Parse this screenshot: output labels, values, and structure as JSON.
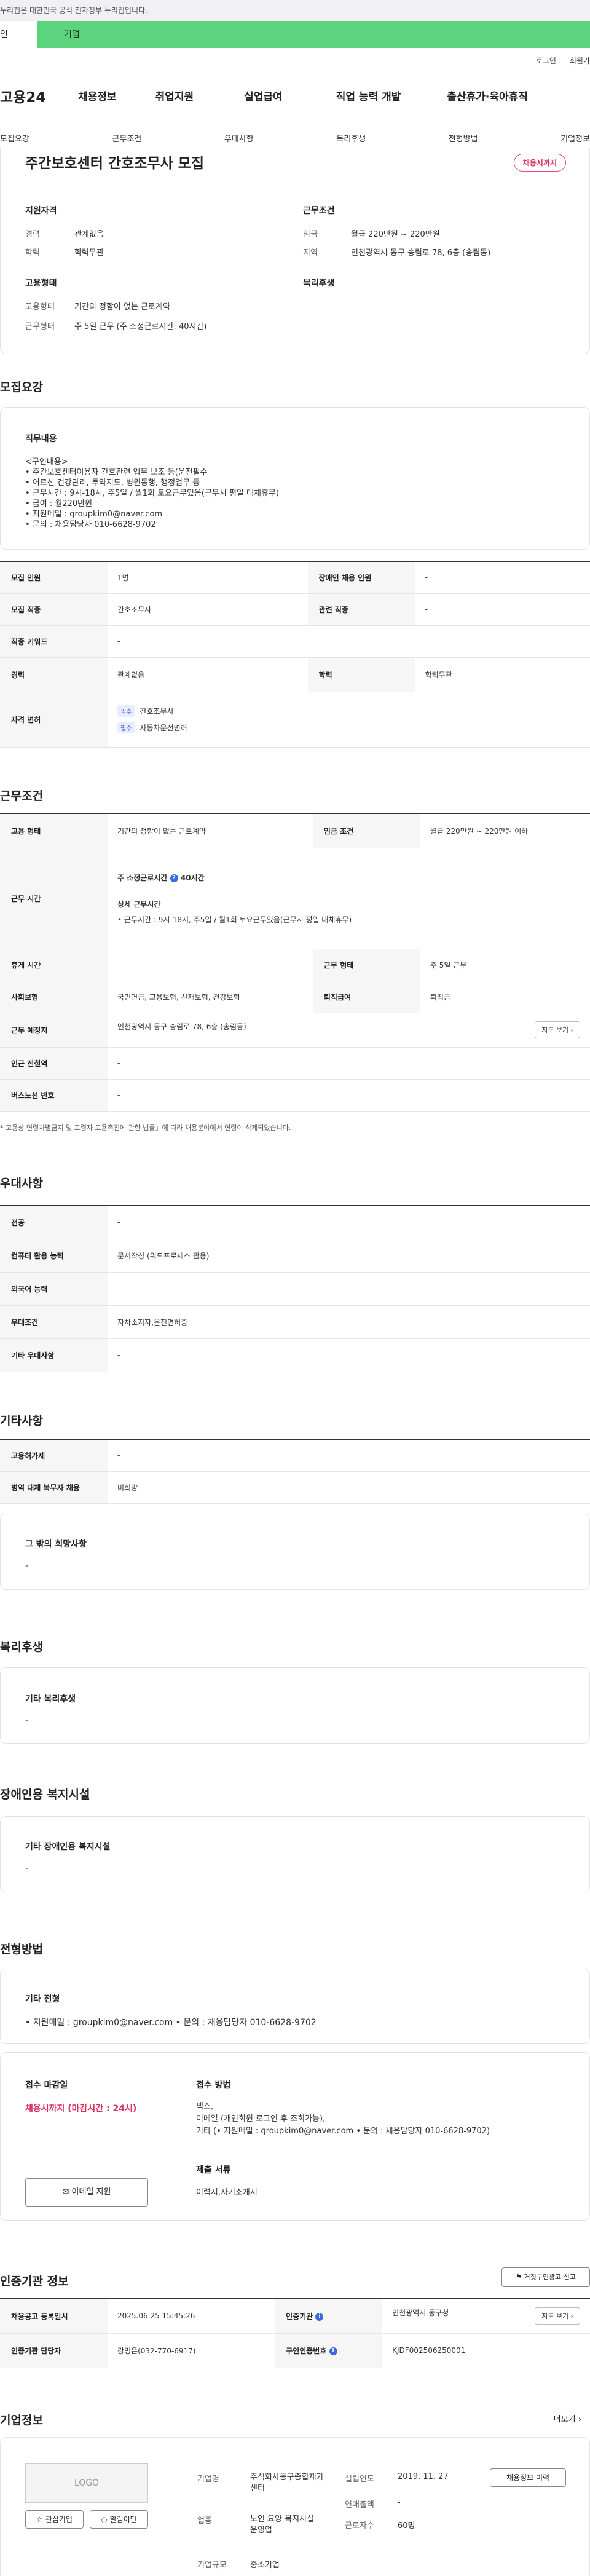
{
  "gov_banner": "누리집은 대한민국 공식 전자정부 누리집입니다.",
  "user_tabs": [
    "인",
    "기업"
  ],
  "util": {
    "login": "로그인",
    "join": "회원가"
  },
  "gnb": {
    "logo": "고용24",
    "items": [
      "채용정보",
      "취업지원",
      "실업급여",
      "직업 능력 개발",
      "출산휴가·육아휴직"
    ]
  },
  "subnav": [
    "모집요강",
    "근무조건",
    "우대사항",
    "복리후생",
    "전형방법",
    "기업정보"
  ],
  "header": {
    "title": "주간보호센터 간호조무사 모집",
    "badge": "채용시까지",
    "qual_title": "지원자격",
    "career_label": "경력",
    "career": "관계없음",
    "edu_label": "학력",
    "edu": "학력무관",
    "cond_title": "근무조건",
    "wage_label": "임금",
    "wage": "월급 220만원 ~ 220만원",
    "loc_label": "지역",
    "loc": "인천광역시 동구 송림로 78, 6층 (송림동)",
    "emp_title": "고용형태",
    "emptype_label": "고용형태",
    "emptype": "기간의 정함이 없는 근로계약",
    "work_label": "근무형태",
    "work": "주 5일 근무 (주 소정근로시간: 40시간)",
    "welfare_title": "복리후생"
  },
  "recruit": {
    "section": "모집요강",
    "duty_title": "직무내용",
    "duty_lines": [
      "<구인내용>",
      "• 주간보호센터이용자 간호관련 업무 보조 등(운전필수",
      "• 어르신 건강관리, 투약지도, 병원동행, 행정업무 등",
      "• 근무시간 : 9시-18시, 주5일 / 월1회 토요근무있음(근무시 평일 대체휴무)",
      "• 급여 : 월220만원",
      "• 지원메일 : groupkim0@naver.com",
      "• 문의 : 채용담당자 010-6628-9702"
    ],
    "rows": {
      "count_label": "모집 인원",
      "count": "1명",
      "disabled_label": "장애인 채용 인원",
      "disabled": "-",
      "job_label": "모집 직종",
      "job": "간호조무사",
      "rel_label": "관련 직종",
      "rel": "-",
      "keyword_label": "직종 키워드",
      "keyword": "-",
      "career_label": "경력",
      "career": "관계없음",
      "edu_label": "학력",
      "edu": "학력무관",
      "license_label": "자격 면허",
      "license_tag": "필수",
      "licenses": [
        "간호조무사",
        "자동차운전면허"
      ]
    }
  },
  "conditions": {
    "section": "근무조건",
    "emptype_label": "고용 형태",
    "emptype": "기간의 정함이 없는 근로계약",
    "wage_label": "임금 조건",
    "wage": "월급 220만원 ~ 220만원 이하",
    "hours_label": "근무 시간",
    "hours_main": "주 소정근로시간",
    "hours_value": "40시간",
    "hours_detail_title": "상세 근무시간",
    "hours_detail": "• 근무시간 : 9시-18시, 주5일 / 월1회 토요근무있음(근무시 평일 대체휴무)",
    "rest_label": "휴게 시간",
    "rest": "-",
    "form_label": "근무 형태",
    "form": "주 5일 근무",
    "ins_label": "사회보험",
    "ins": "국민연금, 고용보험, 산재보험, 건강보험",
    "sev_label": "퇴직급여",
    "sev": "퇴직금",
    "place_label": "근무 예정지",
    "place": "인천광역시 동구 송림로 78, 6층 (송림동)",
    "map_btn": "지도 보기",
    "subway_label": "인근 전철역",
    "subway": "-",
    "bus_label": "버스노선 번호",
    "bus": "-",
    "note": "* 고용상 연령차별금지 및 고령자 고용촉진에 관한 법률」에 따라 채용분야에서 연령이 삭제되었습니다."
  },
  "prefer": {
    "section": "우대사항",
    "rows": [
      [
        "전공",
        "-"
      ],
      [
        "컴퓨터 활용 능력",
        "문서작성 (워드프로세스 활용)"
      ],
      [
        "외국어 능력",
        "-"
      ],
      [
        "우대조건",
        "자차소지자,운전면허증"
      ],
      [
        "기타 우대사항",
        "-"
      ]
    ]
  },
  "etc": {
    "section": "기타사항",
    "rows": [
      [
        "고용허가제",
        "-"
      ],
      [
        "병역 대체 복무자 채용",
        "비희망"
      ]
    ],
    "card_title": "그 밖의 희망사항",
    "card_val": "-"
  },
  "welfare": {
    "section": "복리후생",
    "card_title": "기타 복리후생",
    "card_val": "-"
  },
  "disabled": {
    "section": "장애인용 복지시설",
    "card_title": "기타 장애인용 복지시설",
    "card_val": "-"
  },
  "process": {
    "section": "전형방법",
    "card_title": "기타 전형",
    "card_val": "• 지원메일 : groupkim0@naver.com • 문의 : 채용담당자 010-6628-9702",
    "deadline_title": "접수 마감일",
    "deadline": "채용시까지 (마감시간 : 24시)",
    "email_btn": "이메일 지원",
    "method_title": "접수 방법",
    "method_lines": [
      "팩스,",
      "이메일 (개인회원 로그인 후 조회가능),",
      "기타 (• 지원메일 : groupkim0@naver.com • 문의 : 채용담당자 010-6628-9702)"
    ],
    "docs_title": "제출 서류",
    "docs": "이력서,자기소개서"
  },
  "cert": {
    "section": "인증기관 정보",
    "report_btn": "거짓구인광고 신고",
    "reg_label": "채용공고 등록일시",
    "reg": "2025.06.25 15:45:26",
    "org_label": "인증기관",
    "org": "인천광역시 동구청",
    "map_btn": "지도 보기",
    "mgr_label": "인증기관 담당자",
    "mgr": "강명은(032-770-6917)",
    "no_label": "구인인증번호",
    "no": "KJDF002506250001"
  },
  "company": {
    "section": "기업정보",
    "more": "더보기",
    "logo": "LOGO",
    "fav_btn": "관심기업",
    "notify_btn": "알림이단",
    "name_label": "기업명",
    "name": "주식회사동구종합재가센터",
    "year_label": "설립연도",
    "year": "2019. 11. 27",
    "job_btn": "채용정보 이력",
    "ind_label": "업종",
    "ind": "노인 요양 복지시설 운영업",
    "sales_label": "연매출액",
    "sales": "-",
    "emp_label": "근로자수",
    "emp": "60명",
    "size_label": "기업규모",
    "size": "중소기업"
  }
}
